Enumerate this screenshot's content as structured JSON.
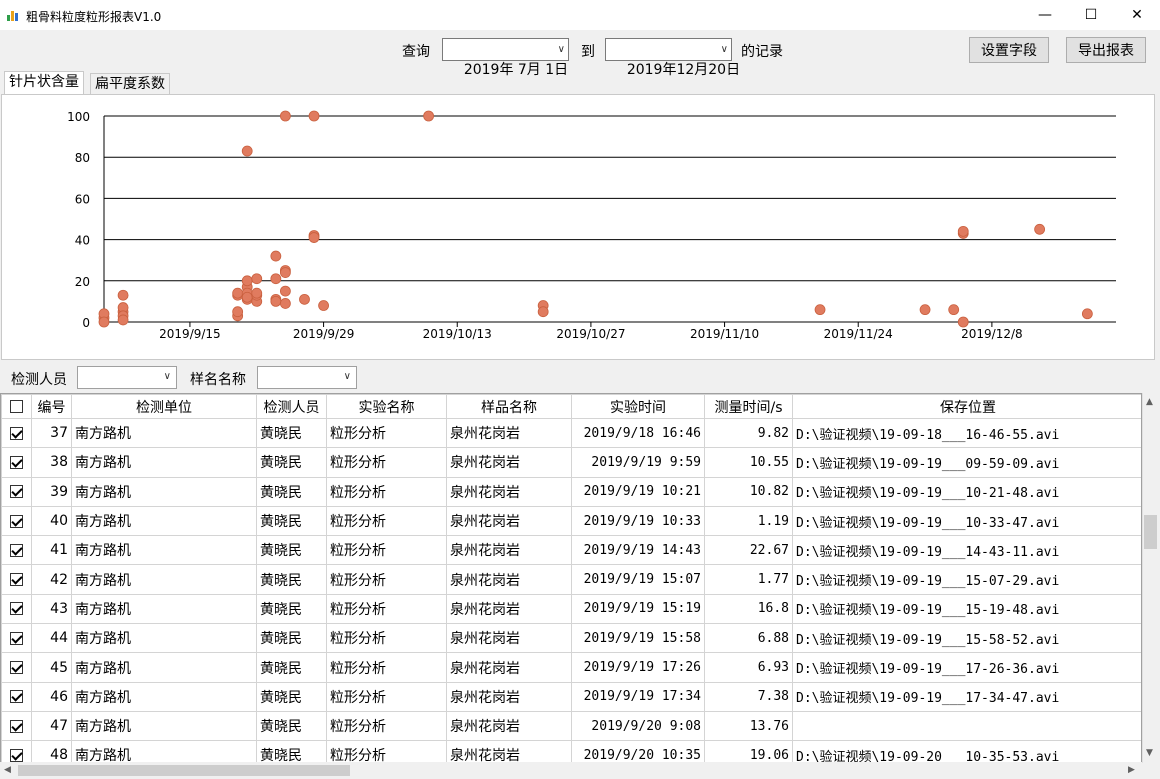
{
  "window": {
    "title": "粗骨料粒度粒形报表V1.0",
    "minimize": "—",
    "maximize": "☐",
    "close": "✕"
  },
  "query": {
    "prefix": "查询",
    "from_date": "2019年 7月 1日",
    "to_label": "到",
    "to_date": "2019年12月20日",
    "suffix": "的记录",
    "settings_button": "设置字段",
    "export_button": "导出报表"
  },
  "tabs": [
    {
      "label": "针片状含量",
      "active": true
    },
    {
      "label": "扁平度系数",
      "active": false
    }
  ],
  "chart_data": {
    "type": "scatter",
    "title": "",
    "xlabel": "",
    "ylabel": "",
    "ylim": [
      0,
      100
    ],
    "yticks": [
      0,
      20,
      40,
      60,
      80,
      100
    ],
    "xlim": [
      "2019-09-06",
      "2019-12-21"
    ],
    "xticks": [
      "2019/9/15",
      "2019/9/29",
      "2019/10/13",
      "2019/10/27",
      "2019/11/10",
      "2019/11/24",
      "2019/12/8"
    ],
    "grid": true,
    "marker_color": "#e07b5f",
    "x": [
      "2019-09-06",
      "2019-09-06",
      "2019-09-06",
      "2019-09-08",
      "2019-09-08",
      "2019-09-08",
      "2019-09-08",
      "2019-09-08",
      "2019-09-20",
      "2019-09-20",
      "2019-09-20",
      "2019-09-20",
      "2019-09-21",
      "2019-09-21",
      "2019-09-21",
      "2019-09-21",
      "2019-09-21",
      "2019-09-21",
      "2019-09-21",
      "2019-09-22",
      "2019-09-22",
      "2019-09-22",
      "2019-09-22",
      "2019-09-24",
      "2019-09-24",
      "2019-09-24",
      "2019-09-24",
      "2019-09-25",
      "2019-09-25",
      "2019-09-25",
      "2019-09-25",
      "2019-09-25",
      "2019-09-27",
      "2019-09-28",
      "2019-09-28",
      "2019-09-28",
      "2019-09-29",
      "2019-10-10",
      "2019-10-22",
      "2019-10-22",
      "2019-11-20",
      "2019-12-01",
      "2019-12-04",
      "2019-12-05",
      "2019-12-05",
      "2019-12-05",
      "2019-12-13",
      "2019-12-18"
    ],
    "y": [
      2,
      4,
      0,
      13,
      5,
      7,
      3,
      1,
      13,
      14,
      3,
      5,
      83,
      17,
      20,
      13,
      11,
      14,
      12,
      10,
      13,
      21,
      14,
      32,
      21,
      11,
      10,
      100,
      25,
      24,
      15,
      9,
      11,
      100,
      42,
      41,
      8,
      100,
      8,
      5,
      6,
      6,
      6,
      0,
      43,
      44,
      45,
      4
    ]
  },
  "filters": {
    "tester_label": "检测人员",
    "sample_label": "样名名称"
  },
  "table": {
    "columns": [
      "",
      "编号",
      "检测单位",
      "检测人员",
      "实验名称",
      "样品名称",
      "实验时间",
      "测量时间/s",
      "保存位置"
    ],
    "rows": [
      [
        "37",
        "南方路机",
        "黄晓民",
        "粒形分析",
        "泉州花岗岩",
        "2019/9/18 16:46",
        "9.82",
        "D:\\验证视频\\19-09-18___16-46-55.avi"
      ],
      [
        "38",
        "南方路机",
        "黄晓民",
        "粒形分析",
        "泉州花岗岩",
        "2019/9/19 9:59",
        "10.55",
        "D:\\验证视频\\19-09-19___09-59-09.avi"
      ],
      [
        "39",
        "南方路机",
        "黄晓民",
        "粒形分析",
        "泉州花岗岩",
        "2019/9/19 10:21",
        "10.82",
        "D:\\验证视频\\19-09-19___10-21-48.avi"
      ],
      [
        "40",
        "南方路机",
        "黄晓民",
        "粒形分析",
        "泉州花岗岩",
        "2019/9/19 10:33",
        "1.19",
        "D:\\验证视频\\19-09-19___10-33-47.avi"
      ],
      [
        "41",
        "南方路机",
        "黄晓民",
        "粒形分析",
        "泉州花岗岩",
        "2019/9/19 14:43",
        "22.67",
        "D:\\验证视频\\19-09-19___14-43-11.avi"
      ],
      [
        "42",
        "南方路机",
        "黄晓民",
        "粒形分析",
        "泉州花岗岩",
        "2019/9/19 15:07",
        "1.77",
        "D:\\验证视频\\19-09-19___15-07-29.avi"
      ],
      [
        "43",
        "南方路机",
        "黄晓民",
        "粒形分析",
        "泉州花岗岩",
        "2019/9/19 15:19",
        "16.8",
        "D:\\验证视频\\19-09-19___15-19-48.avi"
      ],
      [
        "44",
        "南方路机",
        "黄晓民",
        "粒形分析",
        "泉州花岗岩",
        "2019/9/19 15:58",
        "6.88",
        "D:\\验证视频\\19-09-19___15-58-52.avi"
      ],
      [
        "45",
        "南方路机",
        "黄晓民",
        "粒形分析",
        "泉州花岗岩",
        "2019/9/19 17:26",
        "6.93",
        "D:\\验证视频\\19-09-19___17-26-36.avi"
      ],
      [
        "46",
        "南方路机",
        "黄晓民",
        "粒形分析",
        "泉州花岗岩",
        "2019/9/19 17:34",
        "7.38",
        "D:\\验证视频\\19-09-19___17-34-47.avi"
      ],
      [
        "47",
        "南方路机",
        "黄晓民",
        "粒形分析",
        "泉州花岗岩",
        "2019/9/20 9:08",
        "13.76",
        ""
      ],
      [
        "48",
        "南方路机",
        "黄晓民",
        "粒形分析",
        "泉州花岗岩",
        "2019/9/20 10:35",
        "19.06",
        "D:\\验证视频\\19-09-20___10-35-53.avi"
      ]
    ]
  }
}
